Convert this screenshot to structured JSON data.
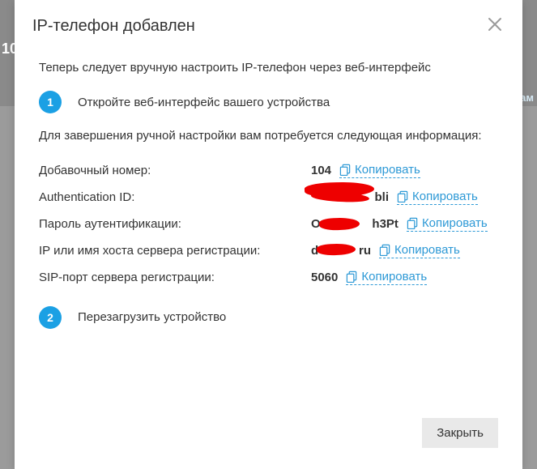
{
  "modal": {
    "title": "IP-телефон добавлен",
    "intro": "Теперь следует вручную настроить IP-телефон через веб-интерфейс",
    "step1_label": "Откройте веб-интерфейс вашего устройства",
    "subtext": "Для завершения ручной настройки вам потребуется следующая информация:",
    "step2_label": "Перезагрузить устройство",
    "close_btn": "Закрыть"
  },
  "steps": {
    "num1": "1",
    "num2": "2"
  },
  "fields": {
    "ext_label": "Добавочный номер:",
    "ext_value": "104",
    "authid_label": "Authentication ID:",
    "authid_value": "███████bli",
    "pass_label": "Пароль аутентификации:",
    "pass_value": "O██████h3Pt",
    "host_label": "IP или имя хоста сервера регистрации:",
    "host_value": "d████ru",
    "port_label": "SIP-порт сервера регистрации:",
    "port_value": "5060"
  },
  "copy_label": "Копировать",
  "bg": {
    "num": "10",
    "right": "ам"
  }
}
